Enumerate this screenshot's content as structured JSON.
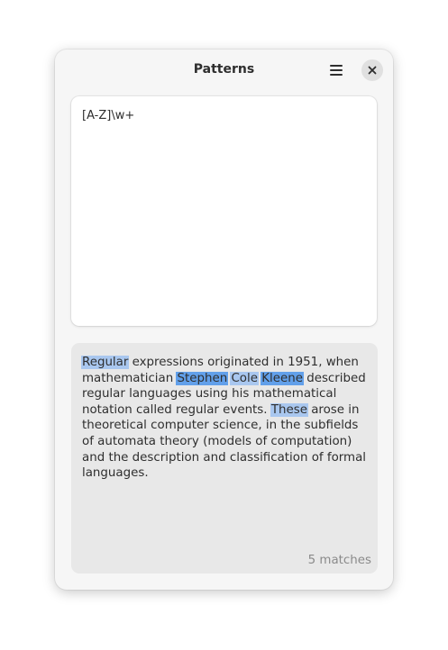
{
  "window": {
    "title": "Patterns"
  },
  "header": {
    "menu_icon": "hamburger-menu-icon",
    "close_icon": "close-icon"
  },
  "pattern": {
    "value": "[A-Z]\\w+"
  },
  "test_text": {
    "segments": [
      {
        "text": "Regular",
        "match": true,
        "style": "light"
      },
      {
        "text": " expressions originated in 1951, when mathematician ",
        "match": false
      },
      {
        "text": "Stephen",
        "match": true,
        "style": "strong"
      },
      {
        "text": " ",
        "match": false
      },
      {
        "text": "Cole",
        "match": true,
        "style": "light"
      },
      {
        "text": " ",
        "match": false
      },
      {
        "text": "Kleene",
        "match": true,
        "style": "strong"
      },
      {
        "text": " described regular languages using his mathematical notation called regular events. ",
        "match": false
      },
      {
        "text": "These",
        "match": true,
        "style": "light"
      },
      {
        "text": " arose in theoretical computer science, in the subfields of automata theory (models of computation) and the description and classification of formal languages.",
        "match": false
      }
    ]
  },
  "status": {
    "match_count": "5 matches"
  },
  "colors": {
    "highlight_light": "#a9c7ef",
    "highlight_strong": "#62a0ea"
  }
}
